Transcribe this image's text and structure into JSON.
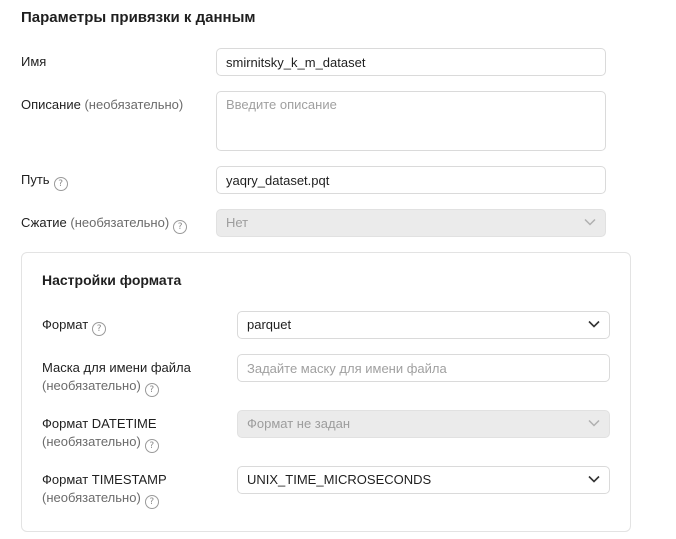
{
  "title": "Параметры привязки к данным",
  "name_field": {
    "label": "Имя",
    "value": "smirnitsky_k_m_dataset"
  },
  "description_field": {
    "label": "Описание",
    "optional": "(необязательно)",
    "placeholder": "Введите описание"
  },
  "path_field": {
    "label": "Путь",
    "value": "yaqry_dataset.pqt",
    "help_icon": "?"
  },
  "compression_field": {
    "label": "Сжатие",
    "optional": "(необязательно)",
    "value": "Нет",
    "help_icon": "?"
  },
  "format_settings": {
    "title": "Настройки формата",
    "format": {
      "label": "Формат",
      "value": "parquet",
      "help_icon": "?"
    },
    "file_mask": {
      "label": "Маска для имени файла",
      "optional": "(необязательно)",
      "placeholder": "Задайте маску для имени файла",
      "help_icon": "?"
    },
    "datetime_format": {
      "label": "Формат DATETIME",
      "optional": "(необязательно)",
      "value": "Формат не задан",
      "help_icon": "?"
    },
    "timestamp_format": {
      "label": "Формат TIMESTAMP",
      "optional": "(необязательно)",
      "value": "UNIX_TIME_MICROSECONDS",
      "help_icon": "?"
    }
  }
}
